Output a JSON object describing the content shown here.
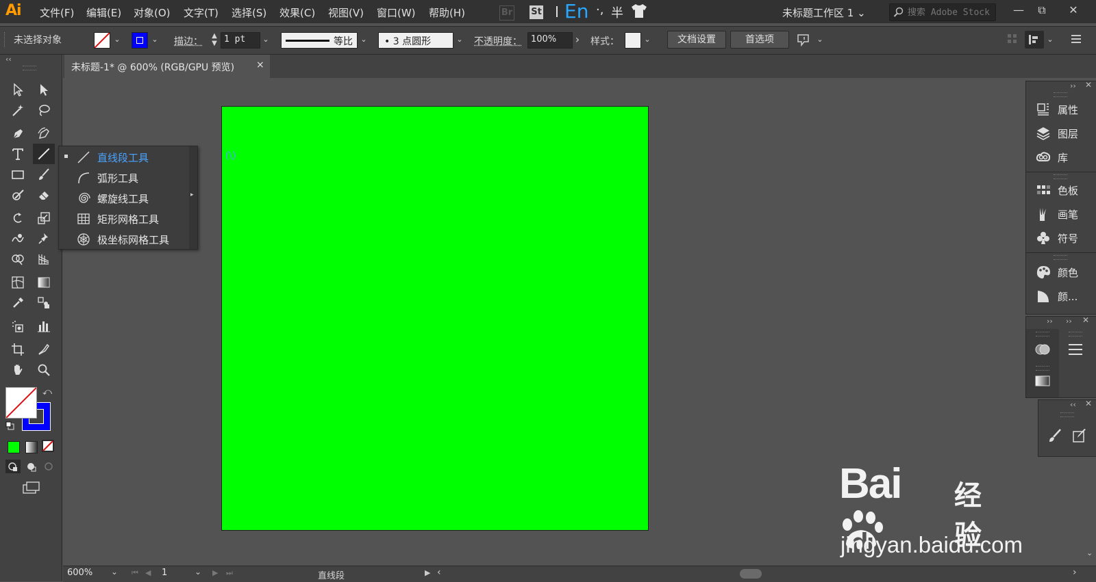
{
  "app": {
    "logo": "Ai"
  },
  "menu": [
    "文件(F)",
    "编辑(E)",
    "对象(O)",
    "文字(T)",
    "选择(S)",
    "效果(C)",
    "视图(V)",
    "窗口(W)",
    "帮助(H)"
  ],
  "bridge": {
    "br": "Br",
    "st": "St"
  },
  "ime": {
    "en": "En",
    "punc": "·,",
    "half": "半"
  },
  "workspace": {
    "label": "未标题工作区 1",
    "arrow": "⌄"
  },
  "stock_search": {
    "placeholder": "搜索 Adobe Stock"
  },
  "window_controls": {
    "minimize": "—",
    "restore": "⧉",
    "close": "✕"
  },
  "control_bar": {
    "selection": "未选择对象",
    "stroke_label": "描边：",
    "stroke_weight": "1 pt",
    "profile_label": "等比",
    "brush": "•  3 点圆形",
    "opacity_label": "不透明度：",
    "opacity_value": "100%",
    "style_label": "样式：",
    "doc_setup": "文档设置",
    "preferences": "首选项",
    "arrow": "›"
  },
  "document_tab": {
    "title": "未标题-1* @ 600% (RGB/GPU 预览)",
    "close": "×"
  },
  "flyout": {
    "items": [
      {
        "label": "直线段工具",
        "icon": "line-segment-icon"
      },
      {
        "label": "弧形工具",
        "icon": "arc-icon"
      },
      {
        "label": "螺旋线工具",
        "icon": "spiral-icon"
      },
      {
        "label": "矩形网格工具",
        "icon": "rectangular-grid-icon"
      },
      {
        "label": "极坐标网格工具",
        "icon": "polar-grid-icon"
      }
    ],
    "shortcut": "(\\)"
  },
  "right_panels": {
    "group1": [
      "属性",
      "图层",
      "库"
    ],
    "group2": [
      "色板",
      "画笔",
      "符号"
    ],
    "group3": [
      "颜色",
      "颜..."
    ]
  },
  "status_bar": {
    "zoom": "600%",
    "page": "1",
    "status": "直线段"
  },
  "watermark": {
    "brand": "Bai",
    "brand2": "du",
    "product": "经验",
    "url": "jingyan.baidu.com"
  },
  "colors": {
    "artboard": "#00ff00",
    "accent": "#4aa3ff",
    "stroke": "#0000ff"
  }
}
